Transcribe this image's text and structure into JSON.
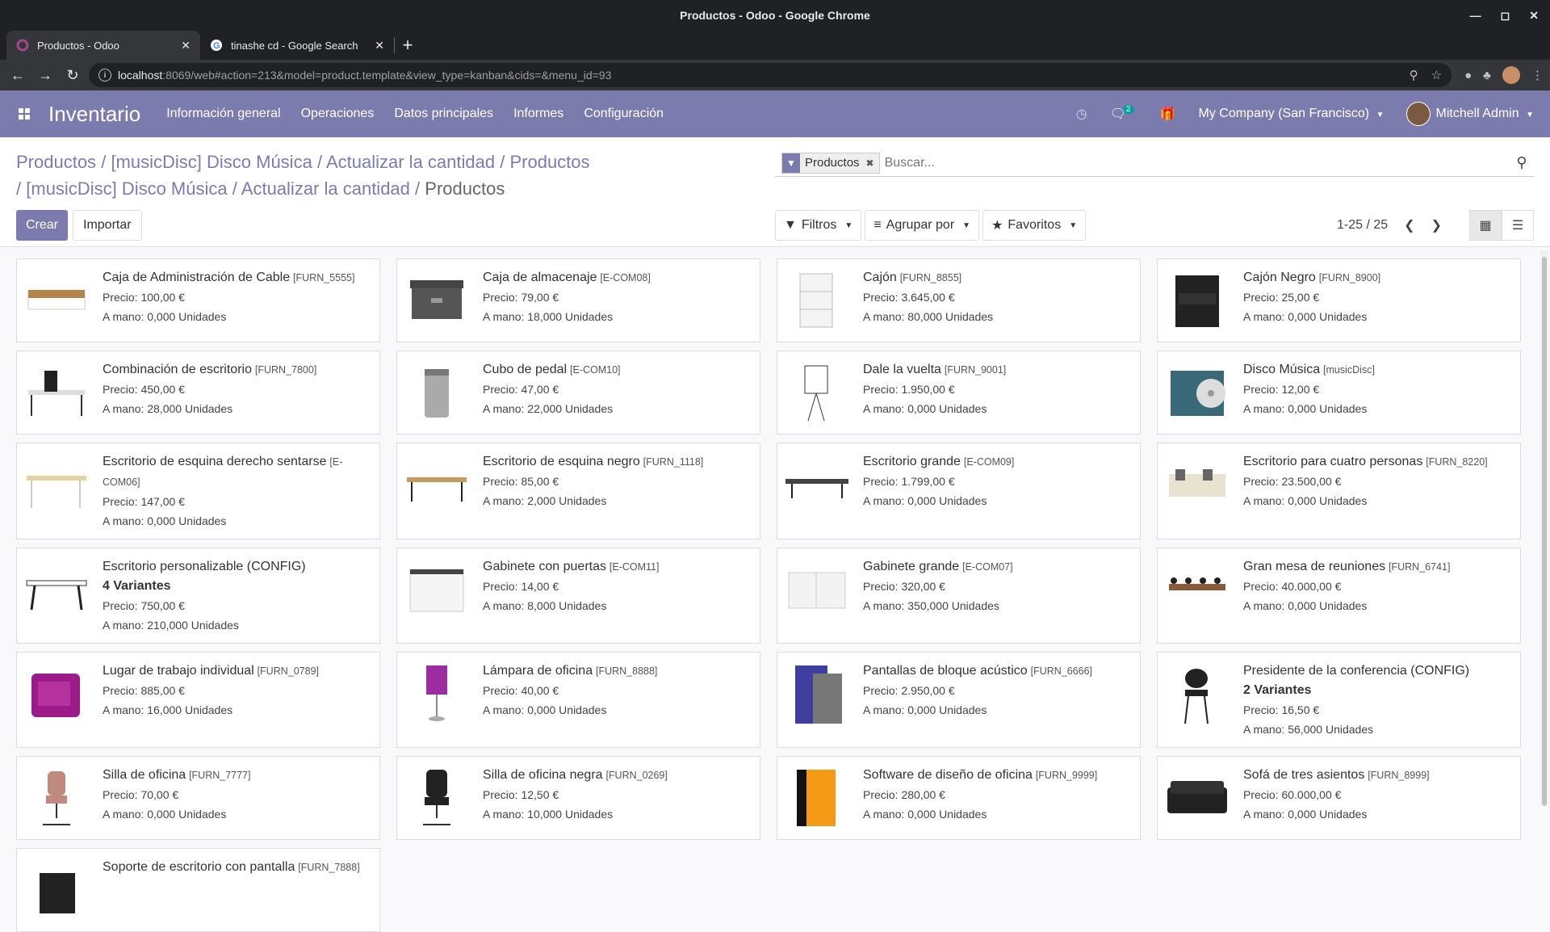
{
  "window": {
    "title": "Productos - Odoo - Google Chrome"
  },
  "tabs": [
    {
      "label": "Productos - Odoo",
      "active": true
    },
    {
      "label": "tinashe cd - Google Search",
      "active": false
    }
  ],
  "address": {
    "host": "localhost",
    "rest": ":8069/web#action=213&model=product.template&view_type=kanban&cids=&menu_id=93"
  },
  "nav": {
    "app_name": "Inventario",
    "menu": [
      "Información general",
      "Operaciones",
      "Datos principales",
      "Informes",
      "Configuración"
    ],
    "messages_badge": "2",
    "company": "My Company (San Francisco)",
    "user": "Mitchell Admin"
  },
  "breadcrumb": {
    "line1": [
      "Productos",
      "[musicDisc] Disco Música",
      "Actualizar la cantidad",
      "Productos"
    ],
    "line2": [
      "[musicDisc] Disco Música",
      "Actualizar la cantidad"
    ],
    "current": "Productos",
    "sep": "/"
  },
  "actions": {
    "create": "Crear",
    "import": "Importar"
  },
  "search": {
    "facet": "Productos",
    "placeholder": "Buscar..."
  },
  "filters": {
    "filters": "Filtros",
    "group_by": "Agrupar por",
    "favorites": "Favoritos"
  },
  "pager": {
    "value": "1-25 / 25"
  },
  "products": [
    {
      "name": "Caja de Administración de Cable",
      "ref": "[FURN_5555]",
      "price": "Precio: 100,00 €",
      "onhand": "A mano: 0,000 Unidades",
      "variants": ""
    },
    {
      "name": "Caja de almacenaje",
      "ref": "[E-COM08]",
      "price": "Precio: 79,00 €",
      "onhand": "A mano: 18,000 Unidades",
      "variants": ""
    },
    {
      "name": "Cajón",
      "ref": "[FURN_8855]",
      "price": "Precio: 3.645,00 €",
      "onhand": "A mano: 80,000 Unidades",
      "variants": ""
    },
    {
      "name": "Cajón Negro",
      "ref": "[FURN_8900]",
      "price": "Precio: 25,00 €",
      "onhand": "A mano: 0,000 Unidades",
      "variants": ""
    },
    {
      "name": "Combinación de escritorio",
      "ref": "[FURN_7800]",
      "price": "Precio: 450,00 €",
      "onhand": "A mano: 28,000 Unidades",
      "variants": ""
    },
    {
      "name": "Cubo de pedal",
      "ref": "[E-COM10]",
      "price": "Precio: 47,00 €",
      "onhand": "A mano: 22,000 Unidades",
      "variants": ""
    },
    {
      "name": "Dale la vuelta",
      "ref": "[FURN_9001]",
      "price": "Precio: 1.950,00 €",
      "onhand": "A mano: 0,000 Unidades",
      "variants": ""
    },
    {
      "name": "Disco Música",
      "ref": "[musicDisc]",
      "price": "Precio: 12,00 €",
      "onhand": "A mano: 0,000 Unidades",
      "variants": ""
    },
    {
      "name": "Escritorio de esquina derecho sentarse",
      "ref": "[E-COM06]",
      "price": "Precio: 147,00 €",
      "onhand": "A mano: 0,000 Unidades",
      "variants": ""
    },
    {
      "name": "Escritorio de esquina negro",
      "ref": "[FURN_1118]",
      "price": "Precio: 85,00 €",
      "onhand": "A mano: 2,000 Unidades",
      "variants": ""
    },
    {
      "name": "Escritorio grande",
      "ref": "[E-COM09]",
      "price": "Precio: 1.799,00 €",
      "onhand": "A mano: 0,000 Unidades",
      "variants": ""
    },
    {
      "name": "Escritorio para cuatro personas",
      "ref": "[FURN_8220]",
      "price": "Precio: 23.500,00 €",
      "onhand": "A mano: 0,000 Unidades",
      "variants": ""
    },
    {
      "name": "Escritorio personalizable (CONFIG)",
      "ref": "",
      "price": "Precio: 750,00 €",
      "onhand": "A mano: 210,000 Unidades",
      "variants": "4 Variantes"
    },
    {
      "name": "Gabinete con puertas",
      "ref": "[E-COM11]",
      "price": "Precio: 14,00 €",
      "onhand": "A mano: 8,000 Unidades",
      "variants": ""
    },
    {
      "name": "Gabinete grande",
      "ref": "[E-COM07]",
      "price": "Precio: 320,00 €",
      "onhand": "A mano: 350,000 Unidades",
      "variants": ""
    },
    {
      "name": "Gran mesa de reuniones",
      "ref": "[FURN_6741]",
      "price": "Precio: 40.000,00 €",
      "onhand": "A mano: 0,000 Unidades",
      "variants": ""
    },
    {
      "name": "Lugar de trabajo individual",
      "ref": "[FURN_0789]",
      "price": "Precio: 885,00 €",
      "onhand": "A mano: 16,000 Unidades",
      "variants": ""
    },
    {
      "name": "Lámpara de oficina",
      "ref": "[FURN_8888]",
      "price": "Precio: 40,00 €",
      "onhand": "A mano: 0,000 Unidades",
      "variants": ""
    },
    {
      "name": "Pantallas de bloque acústico",
      "ref": "[FURN_6666]",
      "price": "Precio: 2.950,00 €",
      "onhand": "A mano: 0,000 Unidades",
      "variants": ""
    },
    {
      "name": "Presidente de la conferencia (CONFIG)",
      "ref": "",
      "price": "Precio: 16,50 €",
      "onhand": "A mano: 56,000 Unidades",
      "variants": "2 Variantes"
    },
    {
      "name": "Silla de oficina",
      "ref": "[FURN_7777]",
      "price": "Precio: 70,00 €",
      "onhand": "A mano: 0,000 Unidades",
      "variants": ""
    },
    {
      "name": "Silla de oficina negra",
      "ref": "[FURN_0269]",
      "price": "Precio: 12,50 €",
      "onhand": "A mano: 10,000 Unidades",
      "variants": ""
    },
    {
      "name": "Software de diseño de oficina",
      "ref": "[FURN_9999]",
      "price": "Precio: 280,00 €",
      "onhand": "A mano: 0,000 Unidades",
      "variants": ""
    },
    {
      "name": "Sofá de tres asientos",
      "ref": "[FURN_8999]",
      "price": "Precio: 60.000,00 €",
      "onhand": "A mano: 0,000 Unidades",
      "variants": ""
    },
    {
      "name": "Soporte de escritorio con pantalla",
      "ref": "[FURN_7888]",
      "price": "",
      "onhand": "",
      "variants": ""
    }
  ],
  "colors": {
    "brand": "#7c7bad",
    "link": "#7c7bad",
    "chrome_dark": "#202124"
  }
}
